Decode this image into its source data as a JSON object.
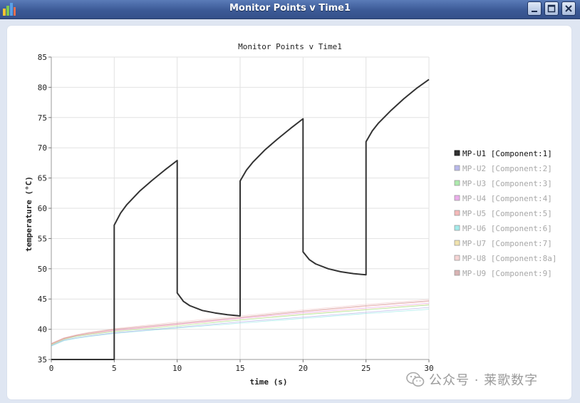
{
  "window": {
    "title": "Monitor Points v Time1",
    "icon": "chart-app-icon",
    "buttons": [
      "minimize-icon",
      "maximize-icon",
      "close-icon"
    ]
  },
  "watermark": {
    "text": "公众号 · 莱歌数字"
  },
  "colors": {
    "titlebar": "#3c5a96",
    "series": [
      "#333333",
      "#8888dd",
      "#77dd77",
      "#dd77dd",
      "#ee8888",
      "#66dddd",
      "#e8d077",
      "#f0b8b8",
      "#c08080"
    ]
  },
  "chart_data": {
    "type": "line",
    "title": "Monitor Points v Time1",
    "xlabel": "time (s)",
    "ylabel": "temperature (°C)",
    "xlim": [
      0,
      30
    ],
    "ylim": [
      35,
      85
    ],
    "xticks": [
      0,
      5,
      10,
      15,
      20,
      25,
      30
    ],
    "yticks": [
      35,
      40,
      45,
      50,
      55,
      60,
      65,
      70,
      75,
      80,
      85
    ],
    "grid": true,
    "legend_position": "right",
    "series": [
      {
        "name": "MP-U1 [Component:1]",
        "active": true,
        "x": [
          0,
          5,
          5,
          5.5,
          6,
          7,
          8,
          9,
          10,
          10,
          10.5,
          11,
          12,
          13,
          14,
          15,
          15,
          15.5,
          16,
          17,
          18,
          19,
          20,
          20,
          20.5,
          21,
          22,
          23,
          24,
          25,
          25,
          25.5,
          26,
          27,
          28,
          29,
          30
        ],
        "y": [
          35,
          35,
          57.2,
          59.2,
          60.6,
          62.8,
          64.6,
          66.3,
          67.9,
          46.0,
          44.6,
          43.9,
          43.1,
          42.7,
          42.4,
          42.2,
          64.5,
          66.3,
          67.6,
          69.7,
          71.5,
          73.2,
          74.8,
          52.8,
          51.5,
          50.8,
          50.0,
          49.5,
          49.2,
          49.0,
          71.0,
          72.8,
          74.1,
          76.2,
          78.1,
          79.8,
          81.3
        ]
      },
      {
        "name": "MP-U2 [Component:2]",
        "active": false,
        "x": [
          0,
          1,
          2,
          3,
          5,
          10,
          15,
          20,
          25,
          30
        ],
        "y": [
          37.3,
          38.2,
          38.6,
          38.9,
          39.4,
          40.3,
          41.2,
          42.0,
          42.8,
          43.6
        ]
      },
      {
        "name": "MP-U3 [Component:3]",
        "active": false,
        "x": [
          0,
          1,
          2,
          3,
          5,
          10,
          15,
          20,
          25,
          30
        ],
        "y": [
          37.4,
          38.3,
          38.8,
          39.1,
          39.6,
          40.5,
          41.5,
          42.4,
          43.2,
          44.0
        ]
      },
      {
        "name": "MP-U4 [Component:4]",
        "active": false,
        "x": [
          0,
          1,
          2,
          3,
          5,
          10,
          15,
          20,
          25,
          30
        ],
        "y": [
          37.5,
          38.4,
          38.9,
          39.2,
          39.8,
          40.8,
          41.8,
          42.7,
          43.5,
          44.3
        ]
      },
      {
        "name": "MP-U5 [Component:5]",
        "active": false,
        "x": [
          0,
          1,
          2,
          3,
          5,
          10,
          15,
          20,
          25,
          30
        ],
        "y": [
          37.6,
          38.5,
          39.0,
          39.3,
          39.9,
          40.9,
          41.9,
          42.9,
          43.8,
          44.6
        ]
      },
      {
        "name": "MP-U6 [Component:6]",
        "active": false,
        "x": [
          0,
          1,
          2,
          3,
          5,
          10,
          15,
          20,
          25,
          30
        ],
        "y": [
          37.2,
          38.1,
          38.5,
          38.8,
          39.3,
          40.2,
          41.0,
          41.8,
          42.6,
          43.3
        ]
      },
      {
        "name": "MP-U7 [Component:7]",
        "active": false,
        "x": [
          0,
          1,
          2,
          3,
          5,
          10,
          15,
          20,
          25,
          30
        ],
        "y": [
          37.5,
          38.4,
          38.9,
          39.2,
          39.7,
          40.7,
          41.6,
          42.5,
          43.3,
          44.1
        ]
      },
      {
        "name": "MP-U8 [Component:8a]",
        "active": false,
        "x": [
          0,
          1,
          2,
          3,
          5,
          10,
          15,
          20,
          25,
          30
        ],
        "y": [
          37.7,
          38.6,
          39.1,
          39.5,
          40.1,
          41.2,
          42.2,
          43.2,
          44.1,
          44.9
        ]
      },
      {
        "name": "MP-U9 [Component:9]",
        "active": false,
        "x": [
          0,
          1,
          2,
          3,
          5,
          10,
          15,
          20,
          25,
          30
        ],
        "y": [
          37.6,
          38.5,
          39.0,
          39.4,
          40.0,
          41.0,
          42.0,
          43.0,
          43.9,
          44.7
        ]
      }
    ]
  }
}
